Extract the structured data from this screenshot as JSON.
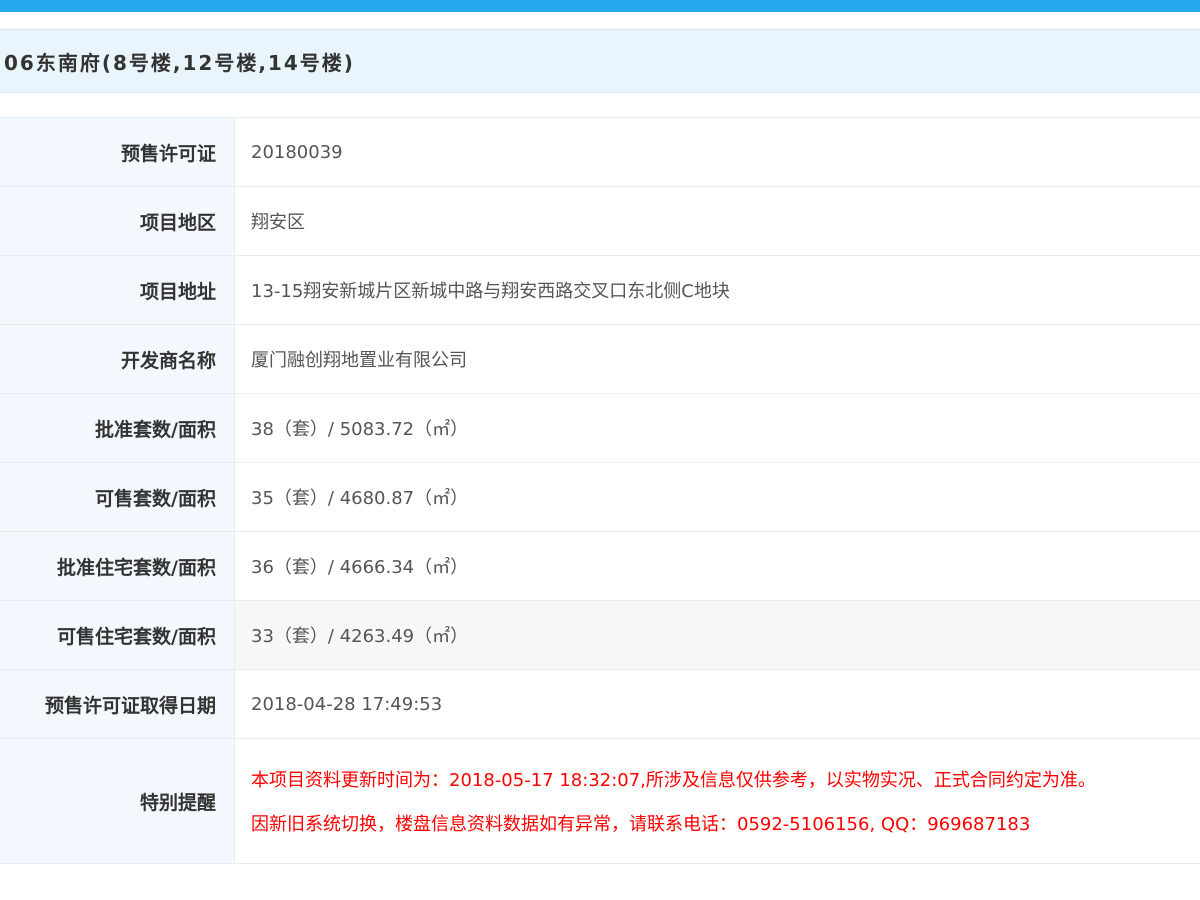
{
  "title": "06东南府(8号楼,12号楼,14号楼)",
  "rows": [
    {
      "label": "预售许可证",
      "value": "20180039"
    },
    {
      "label": "项目地区",
      "value": "翔安区"
    },
    {
      "label": "项目地址",
      "value": "13-15翔安新城片区新城中路与翔安西路交叉口东北侧C地块"
    },
    {
      "label": "开发商名称",
      "value": "厦门融创翔地置业有限公司"
    },
    {
      "label": "批准套数/面积",
      "value": "38（套）/ 5083.72（㎡）"
    },
    {
      "label": "可售套数/面积",
      "value": "35（套）/ 4680.87（㎡）"
    },
    {
      "label": "批准住宅套数/面积",
      "value": "36（套）/ 4666.34（㎡）"
    },
    {
      "label": "可售住宅套数/面积",
      "value": "33（套）/ 4263.49（㎡）"
    },
    {
      "label": "预售许可证取得日期",
      "value": "2018-04-28 17:49:53"
    }
  ],
  "notice": {
    "label": "特别提醒",
    "line1": "本项目资料更新时间为：2018-05-17 18:32:07,所涉及信息仅供参考，以实物实况、正式合同约定为准。",
    "line2": "因新旧系统切换，楼盘信息资料数据如有异常，请联系电话：0592-5106156, QQ：969687183"
  },
  "colors": {
    "accent": "#27a7ee",
    "notice_text": "#ff0000",
    "label_background": "#f2f8fd"
  }
}
